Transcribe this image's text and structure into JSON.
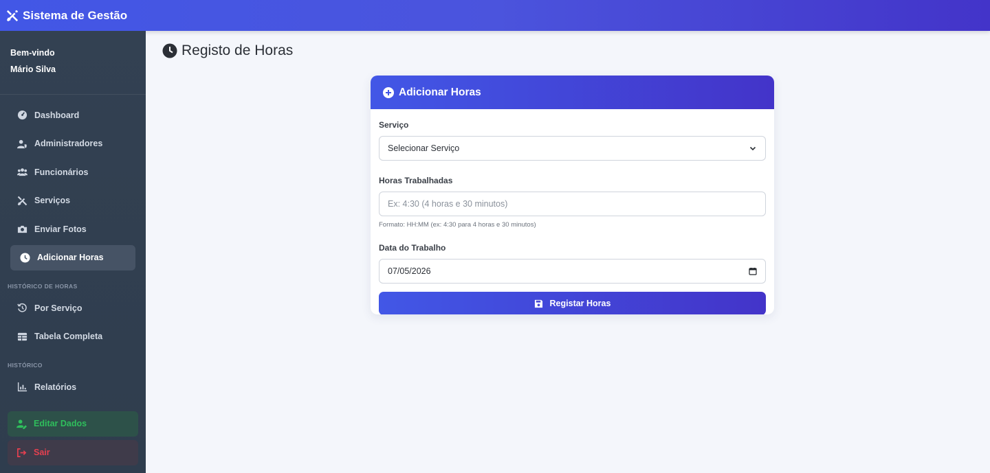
{
  "app": {
    "title": "Sistema de Gestão"
  },
  "sidebar": {
    "welcome": "Bem-vindo",
    "user": "Mário Silva",
    "items": [
      {
        "label": "Dashboard",
        "icon": "gauge-icon"
      },
      {
        "label": "Administradores",
        "icon": "user-shield-icon"
      },
      {
        "label": "Funcionários",
        "icon": "users-icon"
      },
      {
        "label": "Serviços",
        "icon": "tools-icon"
      },
      {
        "label": "Enviar Fotos",
        "icon": "camera-icon"
      },
      {
        "label": "Adicionar Horas",
        "icon": "clock-icon",
        "active": true
      }
    ],
    "section_hours": "HISTÓRICO DE HORAS",
    "hours_items": [
      {
        "label": "Por Serviço",
        "icon": "history-icon"
      },
      {
        "label": "Tabela Completa",
        "icon": "table-icon"
      }
    ],
    "section_history": "HISTÓRICO",
    "history_items": [
      {
        "label": "Relatórios",
        "icon": "chart-icon"
      }
    ],
    "edit_label": "Editar Dados",
    "logout_label": "Sair"
  },
  "page": {
    "title": "Registo de Horas"
  },
  "form": {
    "header": "Adicionar Horas",
    "service_label": "Serviço",
    "service_value": "Selecionar Serviço",
    "hours_label": "Horas Trabalhadas",
    "hours_placeholder": "Ex: 4:30 (4 horas e 30 minutos)",
    "hours_hint": "Formato: HH:MM (ex: 4:30 para 4 horas e 30 minutos)",
    "date_label": "Data do Trabalho",
    "date_value": "07/05/2026",
    "submit_label": "Registar Horas"
  },
  "colors": {
    "primary": "#4257e6",
    "primary_dark": "#4334c9",
    "sidebar": "#334152",
    "success": "#2fbf5c",
    "danger": "#e64050"
  }
}
